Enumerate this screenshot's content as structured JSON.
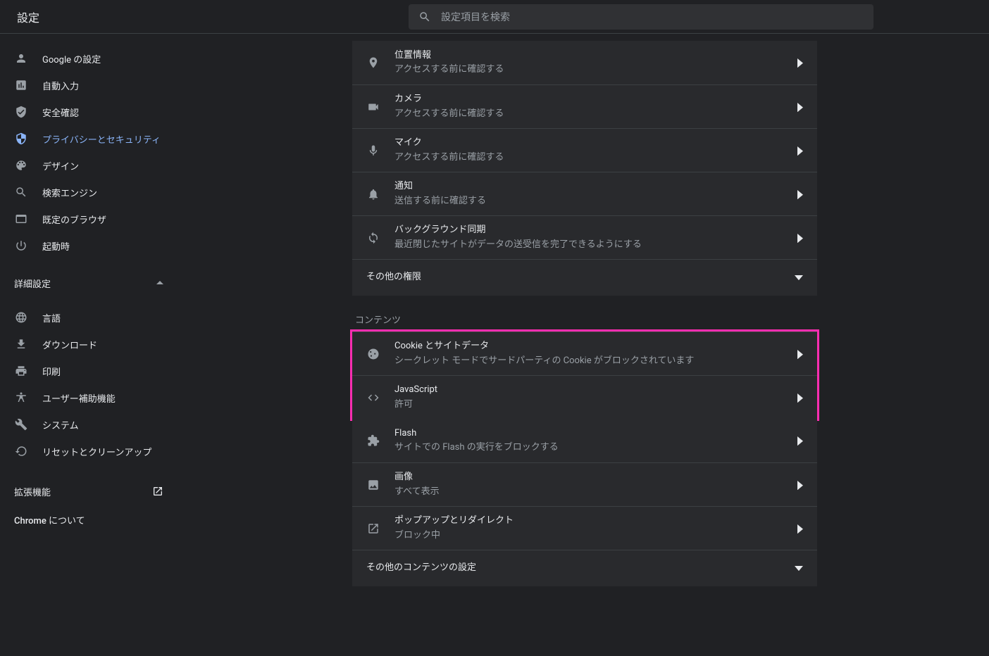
{
  "header": {
    "title": "設定",
    "search_placeholder": "設定項目を検索"
  },
  "sidebar": {
    "items": [
      {
        "label": "Google の設定",
        "icon": "person"
      },
      {
        "label": "自動入力",
        "icon": "autofill"
      },
      {
        "label": "安全確認",
        "icon": "shield-check"
      },
      {
        "label": "プライバシーとセキュリティ",
        "icon": "shield-half",
        "active": true
      },
      {
        "label": "デザイン",
        "icon": "palette"
      },
      {
        "label": "検索エンジン",
        "icon": "search"
      },
      {
        "label": "既定のブラウザ",
        "icon": "browser"
      },
      {
        "label": "起動時",
        "icon": "power"
      }
    ],
    "advanced_label": "詳細設定",
    "advanced_items": [
      {
        "label": "言語",
        "icon": "globe"
      },
      {
        "label": "ダウンロード",
        "icon": "download"
      },
      {
        "label": "印刷",
        "icon": "print"
      },
      {
        "label": "ユーザー補助機能",
        "icon": "accessibility"
      },
      {
        "label": "システム",
        "icon": "wrench"
      },
      {
        "label": "リセットとクリーンアップ",
        "icon": "restore"
      }
    ],
    "extensions_label": "拡張機能",
    "about_label": "Chrome について"
  },
  "main": {
    "permissions": [
      {
        "title": "位置情報",
        "sub": "アクセスする前に確認する",
        "icon": "location"
      },
      {
        "title": "カメラ",
        "sub": "アクセスする前に確認する",
        "icon": "camera"
      },
      {
        "title": "マイク",
        "sub": "アクセスする前に確認する",
        "icon": "mic"
      },
      {
        "title": "通知",
        "sub": "送信する前に確認する",
        "icon": "bell"
      },
      {
        "title": "バックグラウンド同期",
        "sub": "最近閉じたサイトがデータの送受信を完了できるようにする",
        "icon": "sync"
      }
    ],
    "other_permissions_label": "その他の権限",
    "content_label": "コンテンツ",
    "highlighted": [
      {
        "title": "Cookie とサイトデータ",
        "sub": "シークレット モードでサードパーティの Cookie がブロックされています",
        "icon": "cookie"
      },
      {
        "title": "JavaScript",
        "sub": "許可",
        "icon": "code"
      }
    ],
    "content_items": [
      {
        "title": "Flash",
        "sub": "サイトでの Flash の実行をブロックする",
        "icon": "puzzle"
      },
      {
        "title": "画像",
        "sub": "すべて表示",
        "icon": "image"
      },
      {
        "title": "ポップアップとリダイレクト",
        "sub": "ブロック中",
        "icon": "popup"
      }
    ],
    "other_content_label": "その他のコンテンツの設定"
  }
}
